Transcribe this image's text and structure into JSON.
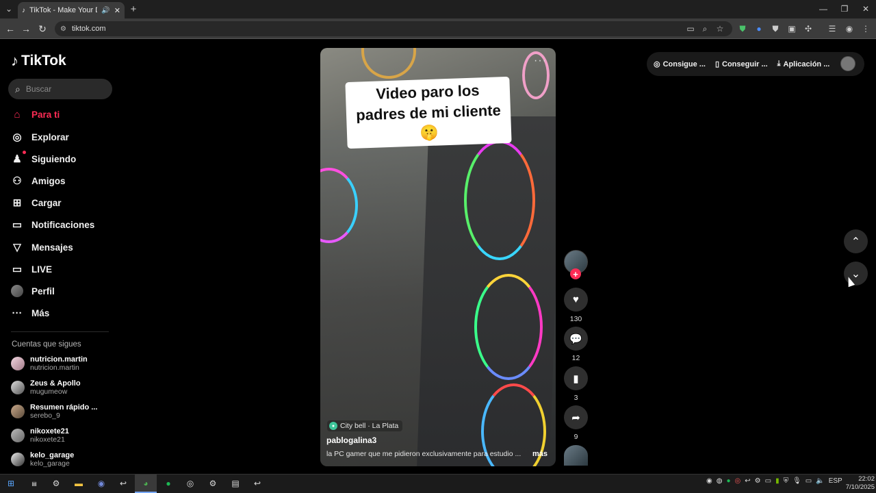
{
  "browser": {
    "tab_title": "TikTok - Make Your Day",
    "url": "tiktok.com",
    "new_tab": "+",
    "back": "←",
    "forward": "→",
    "reload": "↻"
  },
  "sidebar": {
    "logo_text": "TikTok",
    "search_placeholder": "Buscar",
    "items": [
      {
        "label": "Para ti",
        "icon": "home-icon",
        "glyph": "⌂",
        "active": true
      },
      {
        "label": "Explorar",
        "icon": "compass-icon",
        "glyph": "◎"
      },
      {
        "label": "Siguiendo",
        "icon": "person-follow-icon",
        "glyph": "♟"
      },
      {
        "label": "Amigos",
        "icon": "friends-icon",
        "glyph": "⚇"
      },
      {
        "label": "Cargar",
        "icon": "upload-icon",
        "glyph": "⊞"
      },
      {
        "label": "Notificaciones",
        "icon": "inbox-icon",
        "glyph": "▭"
      },
      {
        "label": "Mensajes",
        "icon": "send-icon",
        "glyph": "▽"
      },
      {
        "label": "LIVE",
        "icon": "live-icon",
        "glyph": "▭"
      },
      {
        "label": "Perfil",
        "icon": "avatar-icon",
        "glyph": "●"
      },
      {
        "label": "Más",
        "icon": "more-icon",
        "glyph": "···"
      }
    ],
    "following_title": "Cuentas que sigues",
    "accounts": [
      {
        "name": "nutricion.martin",
        "handle": "nutricion.martin"
      },
      {
        "name": "Zeus & Apollo",
        "handle": "mugumeow"
      },
      {
        "name": "Resumen rápido ...",
        "handle": "serebo_9"
      },
      {
        "name": "nikoxete21",
        "handle": "nikoxete21"
      },
      {
        "name": "kelo_garage",
        "handle": "kelo_garage"
      }
    ]
  },
  "video": {
    "caption": "Video paro los padres de mi cliente 🤫",
    "location": "City bell · La Plata",
    "author": "pablogalina3",
    "description": "la PC gamer que me pidieron exclusivamente para estudio ...",
    "more": "más",
    "more_dots": "···"
  },
  "actions": {
    "follow": "+",
    "likes": "130",
    "comments": "12",
    "saves": "3",
    "shares": "9"
  },
  "topbar": {
    "coins": "Consigue ...",
    "get_app": "Conseguir ...",
    "desktop_app": "Aplicación ..."
  },
  "nav_arrows": {
    "up": "⌃",
    "down": "⌄"
  },
  "taskbar": {
    "lang": "ESP",
    "time": "22:02",
    "date": "7/10/2025"
  }
}
